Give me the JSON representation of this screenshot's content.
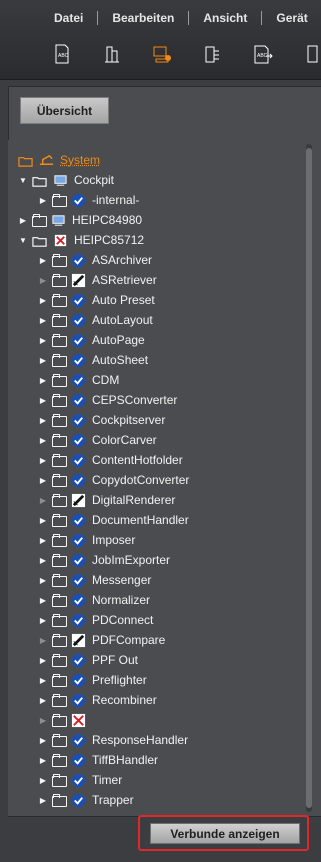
{
  "menu": {
    "items": [
      "Datei",
      "Bearbeiten",
      "Ansicht",
      "Gerät"
    ]
  },
  "toolbar": {
    "icons": [
      "abc-page-icon",
      "server-stack-icon",
      "workflow-icon",
      "pipeline-icon",
      "abc-export-icon"
    ],
    "active": "workflow-icon"
  },
  "tabs": {
    "overview": "Übersicht"
  },
  "tree": {
    "system": "System",
    "cockpit": "Cockpit",
    "internal": "-internal-",
    "heipc84980": "HEIPC84980",
    "heipc85712": "HEIPC85712",
    "children": [
      "ASArchiver",
      "ASRetriever",
      "Auto Preset",
      "AutoLayout",
      "AutoPage",
      "AutoSheet",
      "CDM",
      "CEPSConverter",
      "Cockpitserver",
      "ColorCarver",
      "ContentHotfolder",
      "CopydotConverter",
      "DigitalRenderer",
      "DocumentHandler",
      "Imposer",
      "JobImExporter",
      "Messenger",
      "Normalizer",
      "PDConnect",
      "PDFCompare",
      "PPF Out",
      "Preflighter",
      "Recombiner",
      "",
      "ResponseHandler",
      "TiffBHandler",
      "Timer",
      "Trapper"
    ],
    "child_icons": [
      "check",
      "pen",
      "check",
      "check",
      "check",
      "check",
      "check",
      "check",
      "check",
      "check",
      "check",
      "check",
      "pen",
      "check",
      "check",
      "check",
      "check",
      "check",
      "check",
      "pen",
      "check",
      "check",
      "check",
      "error",
      "check",
      "check",
      "check",
      "check"
    ],
    "arrow_gray": [
      false,
      true,
      false,
      false,
      false,
      false,
      false,
      false,
      false,
      false,
      false,
      false,
      true,
      false,
      false,
      false,
      false,
      false,
      false,
      true,
      false,
      false,
      false,
      true,
      false,
      false,
      false,
      false
    ]
  },
  "footer": {
    "button": "Verbunde anzeigen"
  },
  "colors": {
    "accent": "#f08b13",
    "highlight": "#e1262c"
  }
}
